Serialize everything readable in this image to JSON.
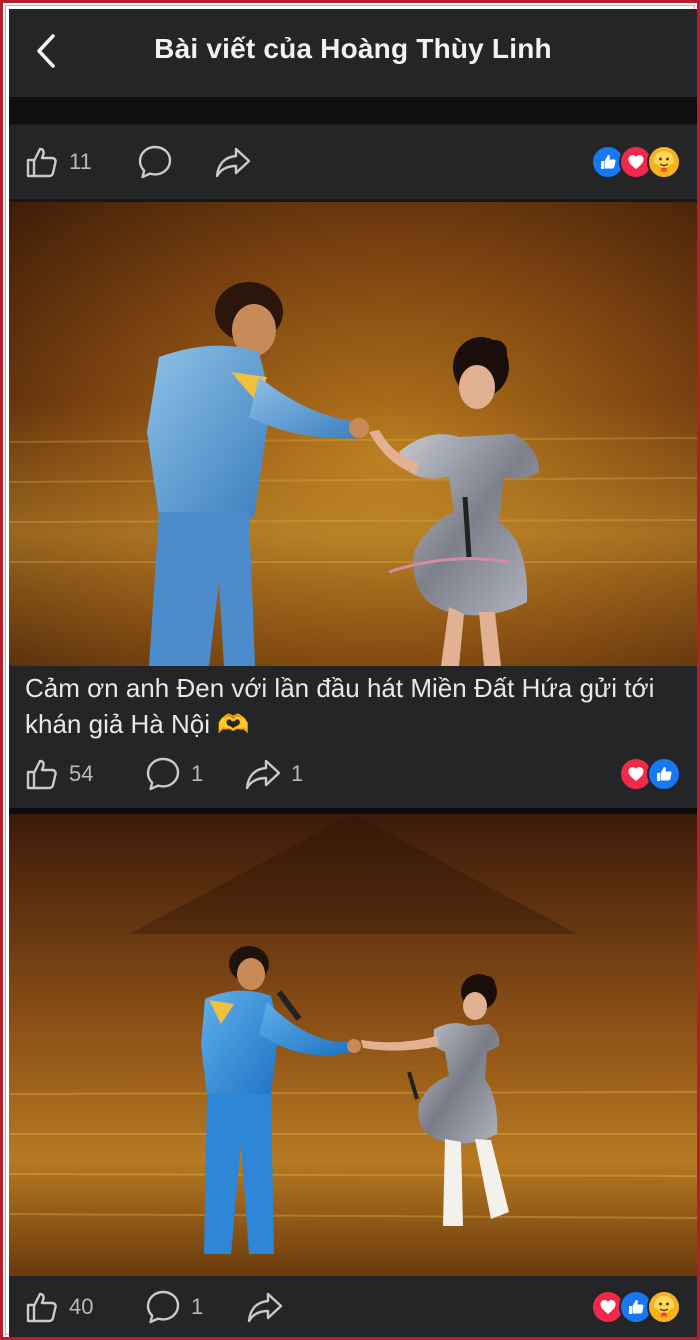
{
  "header": {
    "title": "Bài viết của Hoàng Thùy Linh"
  },
  "posts": [
    {
      "likes": "11",
      "comments": "",
      "shares": "",
      "reactions": [
        "like",
        "love",
        "care"
      ]
    },
    {
      "caption": "Cảm ơn anh Đen với lần đầu hát Miền Đất Hứa gửi tới khán giả Hà Nội",
      "caption_emoji": "🫶",
      "likes": "54",
      "comments": "1",
      "shares": "1",
      "reactions": [
        "love",
        "like"
      ]
    },
    {
      "likes": "40",
      "comments": "1",
      "shares": "",
      "reactions": [
        "love",
        "like",
        "care"
      ]
    }
  ],
  "icons": {
    "back": "chevron-left-icon",
    "like": "thumbs-up-icon",
    "comment": "comment-bubble-icon",
    "share": "share-arrow-icon"
  },
  "colors": {
    "like_blue": "#1877f2",
    "love_red": "#f02849",
    "care_yellow": "#f7b125",
    "background": "#242527"
  }
}
